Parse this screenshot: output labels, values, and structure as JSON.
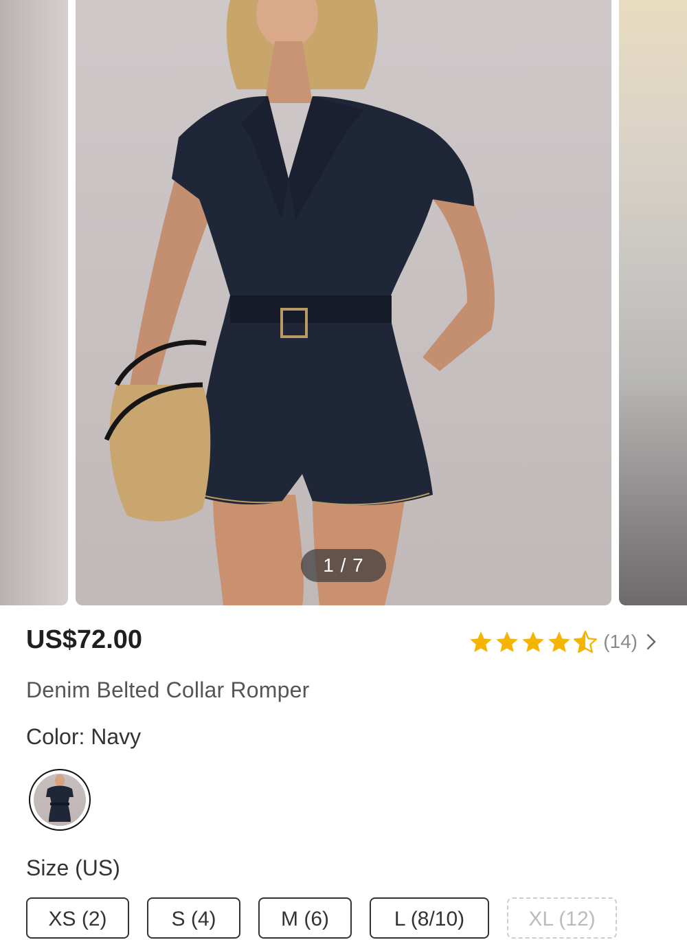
{
  "gallery": {
    "counter": "1 / 7"
  },
  "product": {
    "price": "US$72.00",
    "rating_count": "(14)",
    "rating_value": 4.5,
    "title": "Denim Belted Collar Romper",
    "color_label": "Color: Navy",
    "size_label": "Size (US)",
    "sizes": [
      {
        "label": "XS (2)",
        "available": true
      },
      {
        "label": "S (4)",
        "available": true
      },
      {
        "label": "M (6)",
        "available": true
      },
      {
        "label": "L (8/10)",
        "available": true
      },
      {
        "label": "XL (12)",
        "available": false
      }
    ]
  },
  "colors": {
    "star": "#f5b400",
    "denim": "#1f2638"
  }
}
